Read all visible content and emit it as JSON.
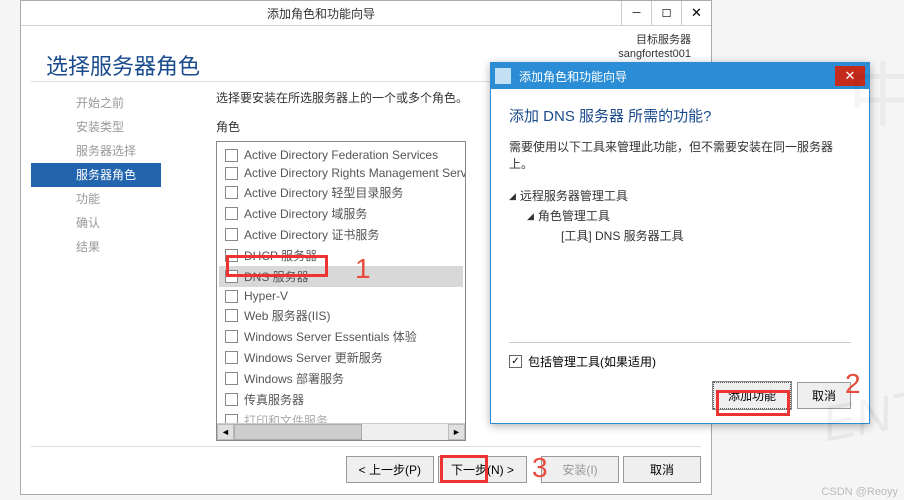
{
  "main": {
    "title": "添加角色和功能向导",
    "dest_label": "目标服务器",
    "dest_server": "sangfortest001",
    "heading": "选择服务器角色",
    "nav": [
      {
        "label": "开始之前"
      },
      {
        "label": "安装类型"
      },
      {
        "label": "服务器选择"
      },
      {
        "label": "服务器角色",
        "active": true
      },
      {
        "label": "功能"
      },
      {
        "label": "确认"
      },
      {
        "label": "结果"
      }
    ],
    "desc": "选择要安装在所选服务器上的一个或多个角色。",
    "roles_label": "角色",
    "roles": [
      {
        "label": "Active Directory Federation Services"
      },
      {
        "label": "Active Directory Rights Management Services"
      },
      {
        "label": "Active Directory 轻型目录服务"
      },
      {
        "label": "Active Directory 域服务"
      },
      {
        "label": "Active Directory 证书服务"
      },
      {
        "label": "DHCP 服务器"
      },
      {
        "label": "DNS 服务器",
        "selected": true
      },
      {
        "label": "Hyper-V"
      },
      {
        "label": "Web 服务器(IIS)"
      },
      {
        "label": "Windows Server Essentials 体验"
      },
      {
        "label": "Windows Server 更新服务"
      },
      {
        "label": "Windows 部署服务"
      },
      {
        "label": "传真服务器"
      },
      {
        "label": "打印和文件服务"
      }
    ],
    "footer": {
      "prev": "< 上一步(P)",
      "next": "下一步(N) >",
      "install": "安装(I)",
      "cancel": "取消"
    }
  },
  "dialog": {
    "title": "添加角色和功能向导",
    "heading": "添加 DNS 服务器 所需的功能?",
    "desc": "需要使用以下工具来管理此功能，但不需要安装在同一服务器上。",
    "tree": {
      "l1": "远程服务器管理工具",
      "l2": "角色管理工具",
      "l3": "[工具] DNS 服务器工具"
    },
    "include_label": "包括管理工具(如果适用)",
    "add": "添加功能",
    "cancel": "取消"
  },
  "annotations": {
    "n1": "1",
    "n2": "2",
    "n3": "3"
  },
  "watermark": "CSDN @Reoyy"
}
